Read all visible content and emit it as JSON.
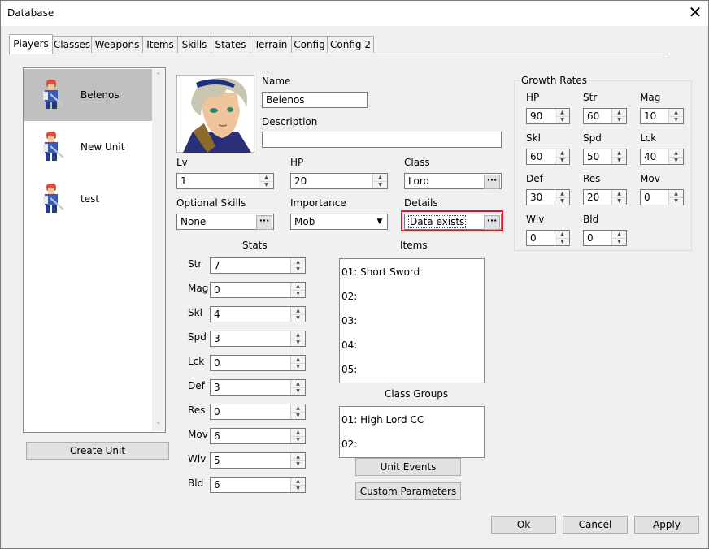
{
  "window": {
    "title": "Database"
  },
  "tabs": [
    "Players",
    "Classes",
    "Weapons",
    "Items",
    "Skills",
    "States",
    "Terrain",
    "Config",
    "Config 2"
  ],
  "units": [
    {
      "name": "Belenos",
      "selected": true
    },
    {
      "name": "New Unit",
      "selected": false
    },
    {
      "name": "test",
      "selected": false
    }
  ],
  "buttons": {
    "create_unit": "Create Unit",
    "unit_events": "Unit Events",
    "custom_parameters": "Custom Parameters",
    "ok": "Ok",
    "cancel": "Cancel",
    "apply": "Apply"
  },
  "form": {
    "name_label": "Name",
    "name_value": "Belenos",
    "description_label": "Description",
    "description_value": "",
    "lv_label": "Lv",
    "lv_value": "1",
    "hp_label": "HP",
    "hp_value": "20",
    "class_label": "Class",
    "class_value": "Lord",
    "optional_skills_label": "Optional Skills",
    "optional_skills_value": "None",
    "importance_label": "Importance",
    "importance_value": "Mob",
    "details_label": "Details",
    "details_value": "Data exists"
  },
  "stats": {
    "title": "Stats",
    "rows": [
      {
        "label": "Str",
        "value": "7"
      },
      {
        "label": "Mag",
        "value": "0"
      },
      {
        "label": "Skl",
        "value": "4"
      },
      {
        "label": "Spd",
        "value": "3"
      },
      {
        "label": "Lck",
        "value": "0"
      },
      {
        "label": "Def",
        "value": "3"
      },
      {
        "label": "Res",
        "value": "0"
      },
      {
        "label": "Mov",
        "value": "6"
      },
      {
        "label": "Wlv",
        "value": "5"
      },
      {
        "label": "Bld",
        "value": "6"
      }
    ]
  },
  "items": {
    "title": "Items",
    "rows": [
      "01: Short Sword",
      "02:",
      "03:",
      "04:",
      "05:"
    ]
  },
  "class_groups": {
    "title": "Class Groups",
    "rows": [
      "01: High Lord CC",
      "02:"
    ]
  },
  "growth": {
    "title": "Growth Rates",
    "cells": [
      {
        "label": "HP",
        "value": "90"
      },
      {
        "label": "Str",
        "value": "60"
      },
      {
        "label": "Mag",
        "value": "10"
      },
      {
        "label": "Skl",
        "value": "60"
      },
      {
        "label": "Spd",
        "value": "50"
      },
      {
        "label": "Lck",
        "value": "40"
      },
      {
        "label": "Def",
        "value": "30"
      },
      {
        "label": "Res",
        "value": "20"
      },
      {
        "label": "Mov",
        "value": "0"
      },
      {
        "label": "Wlv",
        "value": "0"
      },
      {
        "label": "Bld",
        "value": "0"
      }
    ]
  },
  "colors": {
    "highlight": "#e81123",
    "selected_row": "#c0c0c0"
  },
  "icons": {
    "close": "close-icon",
    "spinner": "spin-arrows-icon",
    "ellipsis": "ellipsis-icon",
    "dropdown": "chevron-down-icon",
    "portrait": "character-portrait",
    "sprite": "unit-sprite-icon"
  }
}
